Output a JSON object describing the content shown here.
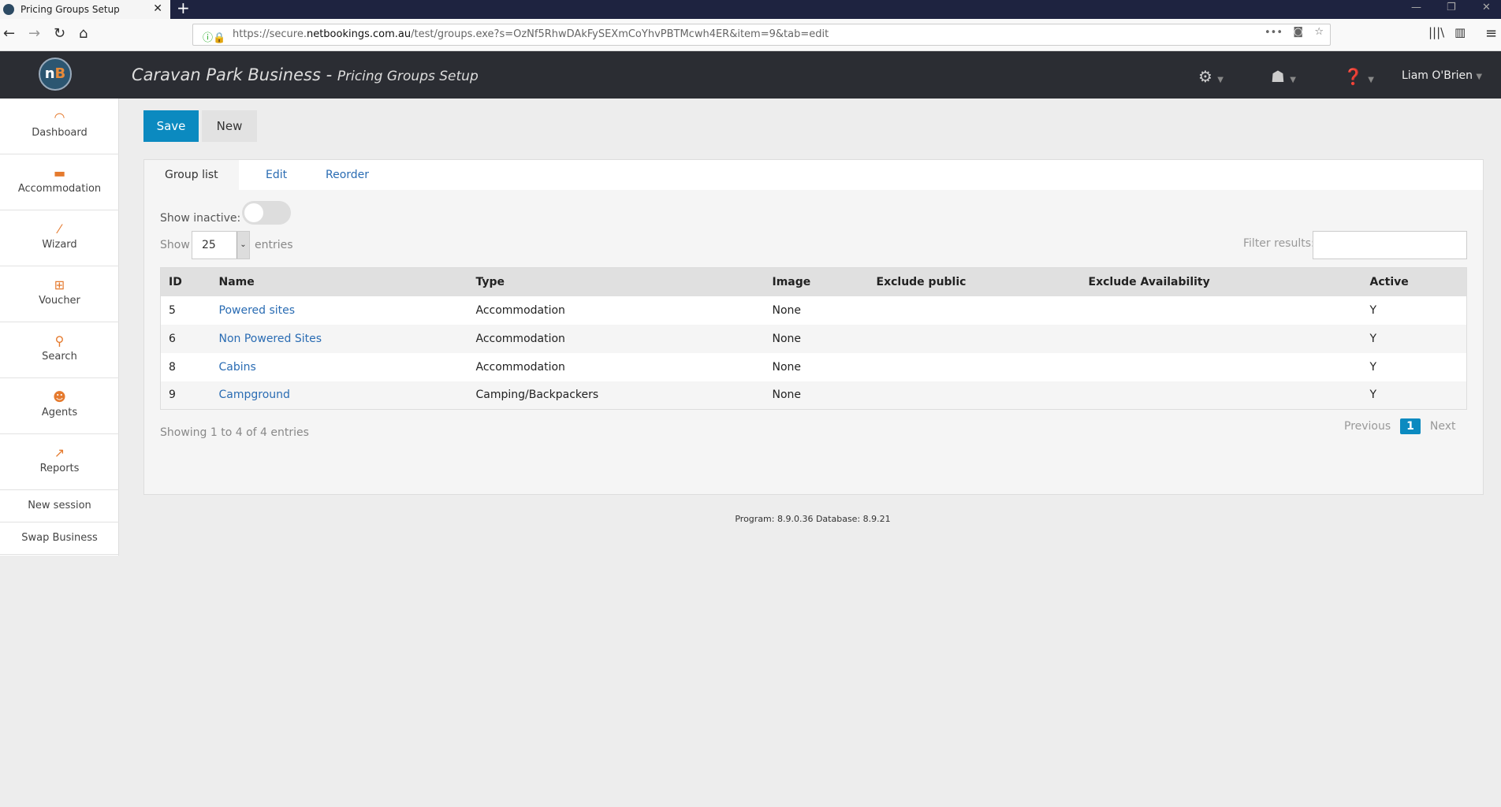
{
  "browser": {
    "tab_title": "Pricing Groups Setup",
    "url_prefix": "https://secure.",
    "url_domain": "netbookings.com.au",
    "url_path": "/test/groups.exe?s=OzNf5RhwDAkFySEXmCoYhvPBTMcwh4ER&item=9&tab=edit"
  },
  "header": {
    "logo": "nB",
    "business": "Caravan Park Business",
    "separator": " - ",
    "page": "Pricing Groups Setup",
    "user": "Liam O'Brien"
  },
  "sidebar": {
    "items": [
      {
        "label": "Dashboard",
        "icon": "◠"
      },
      {
        "label": "Accommodation",
        "icon": "▬"
      },
      {
        "label": "Wizard",
        "icon": "⁄"
      },
      {
        "label": "Voucher",
        "icon": "⊞"
      },
      {
        "label": "Search",
        "icon": "⚲"
      },
      {
        "label": "Agents",
        "icon": "☻"
      },
      {
        "label": "Reports",
        "icon": "↗"
      }
    ],
    "links": [
      "New session",
      "Swap Business"
    ]
  },
  "toolbar": {
    "save": "Save",
    "new": "New"
  },
  "tabs": [
    "Group list",
    "Edit",
    "Reorder"
  ],
  "controls": {
    "show_inactive": "Show inactive:",
    "show_inactive_on": false,
    "show": "Show",
    "page_length": "25",
    "entries": "entries",
    "filter_label": "Filter results:",
    "filter_value": ""
  },
  "table": {
    "columns": [
      "ID",
      "Name",
      "Type",
      "Image",
      "Exclude public",
      "Exclude Availability",
      "Active"
    ],
    "rows": [
      [
        "5",
        "Powered sites",
        "Accommodation",
        "None",
        "",
        "",
        "Y"
      ],
      [
        "6",
        "Non Powered Sites",
        "Accommodation",
        "None",
        "",
        "",
        "Y"
      ],
      [
        "8",
        "Cabins",
        "Accommodation",
        "None",
        "",
        "",
        "Y"
      ],
      [
        "9",
        "Campground",
        "Camping/Backpackers",
        "None",
        "",
        "",
        "Y"
      ]
    ]
  },
  "pagination": {
    "info": "Showing 1 to 4 of 4 entries",
    "previous": "Previous",
    "current": "1",
    "next": "Next"
  },
  "footer": "Program: 8.9.0.36 Database: 8.9.21"
}
